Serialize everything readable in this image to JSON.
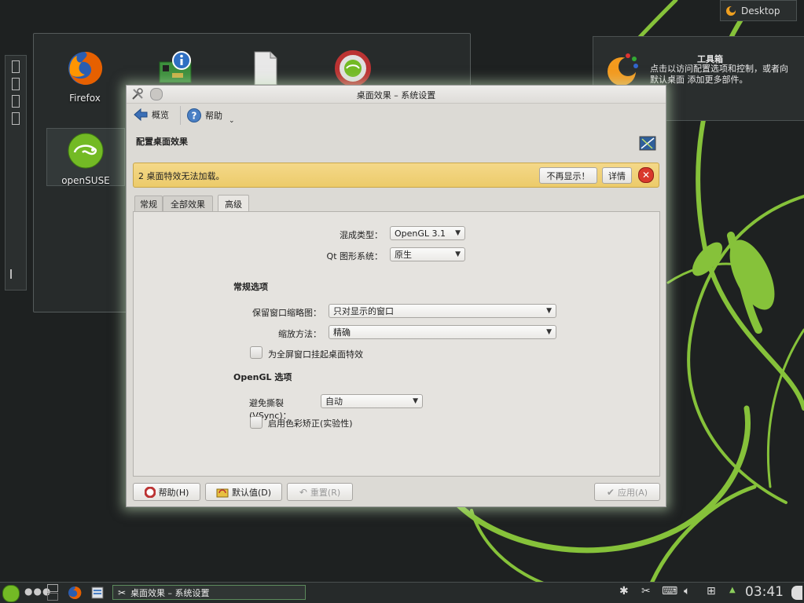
{
  "desktop": {
    "icons": [
      {
        "label": "Firefox"
      },
      {
        "label": ""
      },
      {
        "label": ""
      },
      {
        "label": ""
      },
      {
        "label": "openSUSE"
      }
    ],
    "activity_label": "Desktop"
  },
  "tooltip": {
    "title": "工具箱",
    "body": "点击以访问配置选项和控制，或者向 默认桌面 添加更多部件。"
  },
  "dialog": {
    "title": "桌面效果 – 系统设置",
    "toolbar": {
      "overview": "概览",
      "help": "帮助"
    },
    "page_heading": "配置桌面效果",
    "banner": {
      "message": "2 桌面特效无法加载。",
      "dont_show": "不再显示！",
      "details": "详情"
    },
    "tabs": [
      {
        "label": "常规"
      },
      {
        "label": "全部效果"
      },
      {
        "label": "高级"
      }
    ],
    "compositing_type": {
      "label": "混成类型：",
      "value": "OpenGL 3.1"
    },
    "qt_graphics": {
      "label": "Qt 图形系统：",
      "value": "原生"
    },
    "general_options": {
      "heading": "常规选项",
      "keep_thumbnails": {
        "label": "保留窗口缩略图：",
        "value": "只对显示的窗口"
      },
      "scale_method": {
        "label": "缩放方法：",
        "value": "精确"
      },
      "suspend_fullscreen": {
        "label": "为全屏窗口挂起桌面特效"
      }
    },
    "opengl_options": {
      "heading": "OpenGL 选项",
      "vsync": {
        "label": "避免撕裂(VSync)：",
        "value": "自动"
      },
      "color_correction": {
        "label": "启用色彩矫正(实验性)"
      }
    },
    "buttons": {
      "help": "帮助(H)",
      "defaults": "默认值(D)",
      "reset": "重置(R)",
      "apply": "应用(A)"
    }
  },
  "taskbar": {
    "task_title": "桌面效果 – 系统设置",
    "clock": "03:41"
  },
  "colors": {
    "accent_green": "#7fbf3f",
    "banner_yellow": "#eccb6a",
    "close_red": "#d9382c"
  }
}
